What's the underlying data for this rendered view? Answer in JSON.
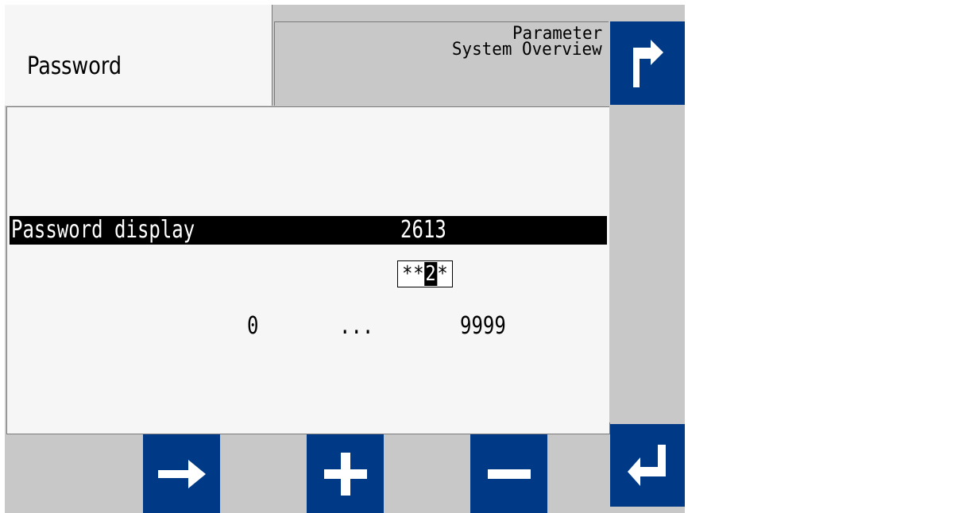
{
  "header": {
    "title": "Password",
    "breadcrumb_line1": "Parameter",
    "breadcrumb_line2": "System Overview"
  },
  "parameter": {
    "label": "Password display",
    "value": "2613",
    "edit_display": {
      "prefix": "**",
      "cursor_char": "2",
      "suffix": "*"
    }
  },
  "range": {
    "min": "0",
    "separator": "...",
    "max": "9999"
  },
  "icons": {
    "back": "return-up-arrow-icon",
    "enter": "enter-icon",
    "next": "right-arrow-icon",
    "plus": "plus-icon",
    "minus": "minus-icon"
  },
  "colors": {
    "button_blue": "#003a87",
    "panel_gray": "#c8c8c8",
    "content_bg": "#f6f6f6",
    "selection_bg": "#000000"
  }
}
